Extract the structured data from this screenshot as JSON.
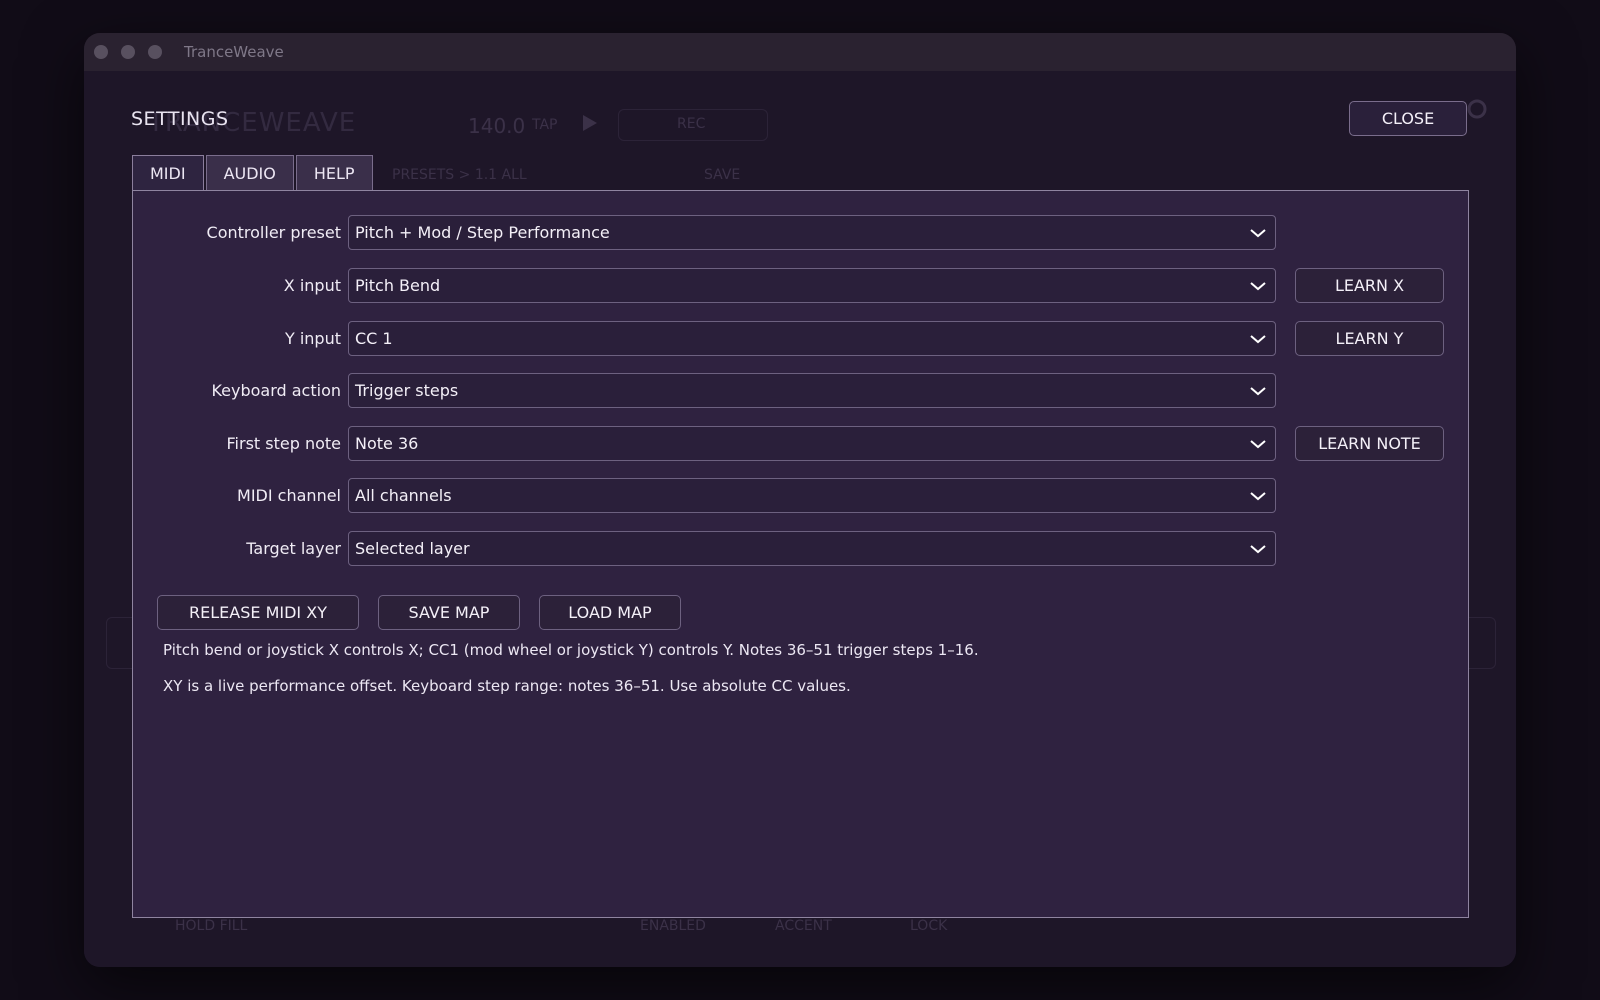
{
  "window": {
    "title": "TranceWeave"
  },
  "background_app": {
    "logo": "TRANCEWEAVE",
    "bpm": "140.0",
    "tap": "TAP",
    "rec": "REC",
    "presets": "PRESETS > 1.1 ALL",
    "save": "SAVE",
    "hold_fill": "HOLD FILL",
    "enabled": "ENABLED",
    "accent": "ACCENT",
    "lock": "LOCK"
  },
  "settings": {
    "title": "SETTINGS",
    "close_label": "CLOSE",
    "tabs": [
      {
        "label": "MIDI",
        "active": true
      },
      {
        "label": "AUDIO",
        "active": false
      },
      {
        "label": "HELP",
        "active": false
      }
    ],
    "rows": [
      {
        "label": "Controller preset",
        "value": "Pitch + Mod / Step Performance"
      },
      {
        "label": "X input",
        "value": "Pitch Bend",
        "learn": "LEARN X"
      },
      {
        "label": "Y input",
        "value": "CC 1",
        "learn": "LEARN Y"
      },
      {
        "label": "Keyboard action",
        "value": "Trigger steps"
      },
      {
        "label": "First step note",
        "value": "Note 36",
        "learn": "LEARN NOTE"
      },
      {
        "label": "MIDI channel",
        "value": "All channels"
      },
      {
        "label": "Target layer",
        "value": "Selected layer"
      }
    ],
    "actions": {
      "release": "RELEASE MIDI XY",
      "save_map": "SAVE MAP",
      "load_map": "LOAD MAP"
    },
    "help": [
      "Pitch bend or joystick X controls X; CC1 (mod wheel or joystick Y) controls Y. Notes 36–51 trigger steps 1–16.",
      "XY is a live performance offset. Keyboard step range: notes 36–51. Use absolute CC values."
    ]
  },
  "icons": {
    "dropdown": "chevron-down-icon"
  }
}
